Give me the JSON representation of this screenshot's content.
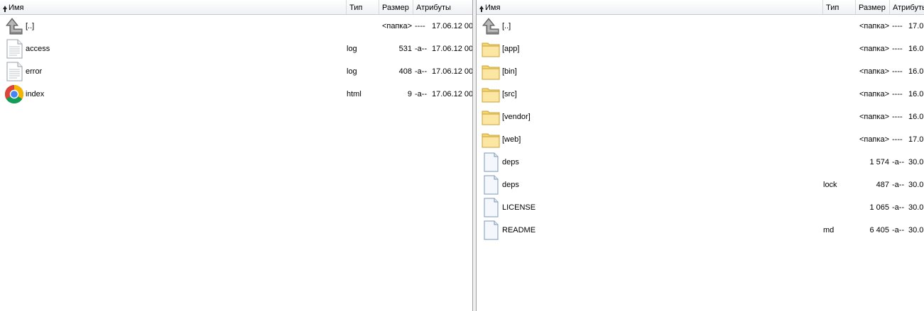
{
  "left": {
    "columns": {
      "name": "Имя",
      "type": "Тип",
      "size": "Размер",
      "attrs": "Атрибуты"
    },
    "rows": [
      {
        "icon": "up-arrow-icon",
        "name": "[..]",
        "type": "",
        "size": "<папка>",
        "attrs": "----",
        "date": "17.06.12 00"
      },
      {
        "icon": "text-file-icon",
        "name": "access",
        "type": "log",
        "size": "531",
        "attrs": "-a--",
        "date": "17.06.12 00"
      },
      {
        "icon": "text-file-icon",
        "name": "error",
        "type": "log",
        "size": "408",
        "attrs": "-a--",
        "date": "17.06.12 00"
      },
      {
        "icon": "chrome-icon",
        "name": "index",
        "type": "html",
        "size": "9",
        "attrs": "-a--",
        "date": "17.06.12 00"
      }
    ]
  },
  "right": {
    "columns": {
      "name": "Имя",
      "type": "Тип",
      "size": "Размер",
      "attrs": "Атрибуты"
    },
    "rows": [
      {
        "icon": "up-arrow-icon",
        "name": "[..]",
        "type": "",
        "size": "<папка>",
        "attrs": "----",
        "date": "17.0"
      },
      {
        "icon": "folder-icon",
        "name": "[app]",
        "type": "",
        "size": "<папка>",
        "attrs": "----",
        "date": "16.0"
      },
      {
        "icon": "folder-icon",
        "name": "[bin]",
        "type": "",
        "size": "<папка>",
        "attrs": "----",
        "date": "16.0"
      },
      {
        "icon": "folder-icon",
        "name": "[src]",
        "type": "",
        "size": "<папка>",
        "attrs": "----",
        "date": "16.0"
      },
      {
        "icon": "folder-icon",
        "name": "[vendor]",
        "type": "",
        "size": "<папка>",
        "attrs": "----",
        "date": "16.0"
      },
      {
        "icon": "folder-icon",
        "name": "[web]",
        "type": "",
        "size": "<папка>",
        "attrs": "----",
        "date": "17.0"
      },
      {
        "icon": "file-icon",
        "name": "deps",
        "type": "",
        "size": "1 574",
        "attrs": "-a--",
        "date": "30.0"
      },
      {
        "icon": "file-icon",
        "name": "deps",
        "type": "lock",
        "size": "487",
        "attrs": "-a--",
        "date": "30.0"
      },
      {
        "icon": "file-icon",
        "name": "LICENSE",
        "type": "",
        "size": "1 065",
        "attrs": "-a--",
        "date": "30.0"
      },
      {
        "icon": "file-icon",
        "name": "README",
        "type": "md",
        "size": "6 405",
        "attrs": "-a--",
        "date": "30.0"
      }
    ]
  },
  "colors": {
    "folder": "#f6d66f",
    "folder_border": "#c9a13a",
    "header_border": "#c9ccd1",
    "panel_border": "#a0a0a0"
  }
}
